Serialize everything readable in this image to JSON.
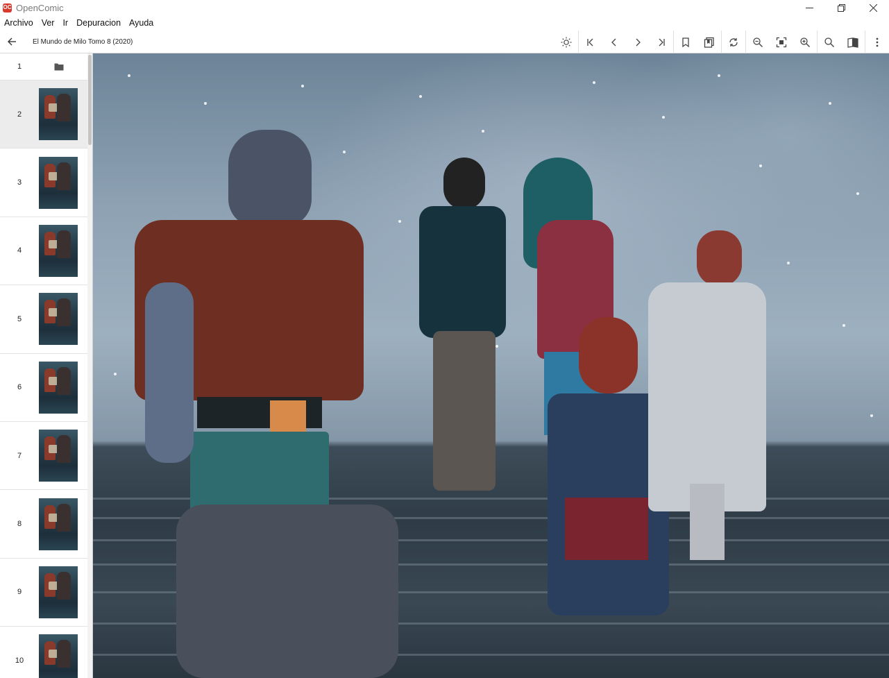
{
  "window": {
    "app_title": "OpenComic",
    "logo_text": "OC"
  },
  "menu": {
    "items": [
      "Archivo",
      "Ver",
      "Ir",
      "Depuracion",
      "Ayuda"
    ]
  },
  "toolbar": {
    "document_title": "El Mundo de Milo Tomo 8 (2020)",
    "buttons": [
      {
        "name": "brightness-icon"
      },
      {
        "name": "first-page-icon"
      },
      {
        "name": "previous-page-icon"
      },
      {
        "name": "next-page-icon"
      },
      {
        "name": "last-page-icon"
      },
      {
        "name": "bookmark-icon"
      },
      {
        "name": "bookmarks-list-icon"
      },
      {
        "name": "rotate-icon"
      },
      {
        "name": "zoom-out-icon"
      },
      {
        "name": "fit-screen-icon"
      },
      {
        "name": "zoom-in-icon"
      },
      {
        "name": "search-icon"
      },
      {
        "name": "reading-mode-icon"
      },
      {
        "name": "more-options-icon"
      }
    ]
  },
  "sidebar": {
    "folder_item": {
      "number": "1"
    },
    "pages": [
      {
        "number": "2",
        "selected": true
      },
      {
        "number": "3"
      },
      {
        "number": "4"
      },
      {
        "number": "5"
      },
      {
        "number": "6"
      },
      {
        "number": "7"
      },
      {
        "number": "8"
      },
      {
        "number": "9"
      },
      {
        "number": "10"
      }
    ]
  },
  "colors": {
    "accent": "#d8392b",
    "selected_row": "#ececec"
  }
}
